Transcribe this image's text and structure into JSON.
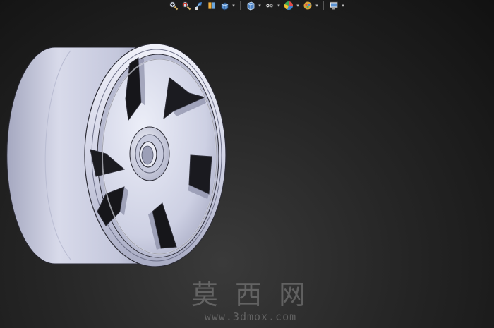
{
  "toolbar": {
    "buttons": [
      {
        "icon": "zoom-to-fit-icon",
        "has_dropdown": false
      },
      {
        "icon": "zoom-to-area-icon",
        "has_dropdown": false
      },
      {
        "icon": "previous-view-icon",
        "has_dropdown": false
      },
      {
        "icon": "section-view-icon",
        "has_dropdown": false
      },
      {
        "icon": "view-orientation-icon",
        "has_dropdown": true
      },
      {
        "icon": "display-style-icon",
        "has_dropdown": true
      },
      {
        "icon": "hide-show-items-icon",
        "has_dropdown": true
      },
      {
        "icon": "edit-appearance-icon",
        "has_dropdown": true
      },
      {
        "icon": "apply-scene-icon",
        "has_dropdown": true
      },
      {
        "icon": "view-settings-icon",
        "has_dropdown": true
      }
    ],
    "dropdown_glyph": "▾"
  },
  "model": {
    "name": "wheel-rim-model",
    "spoke_count": 6,
    "colors": {
      "surface_light": "#e4e6f4",
      "surface_mid": "#c4c7dc",
      "surface_dark": "#8c8fa8",
      "edge": "#2c2c36",
      "background": "#262626"
    }
  },
  "watermark": {
    "title": "莫 西 网",
    "url": "www.3dmox.com"
  }
}
